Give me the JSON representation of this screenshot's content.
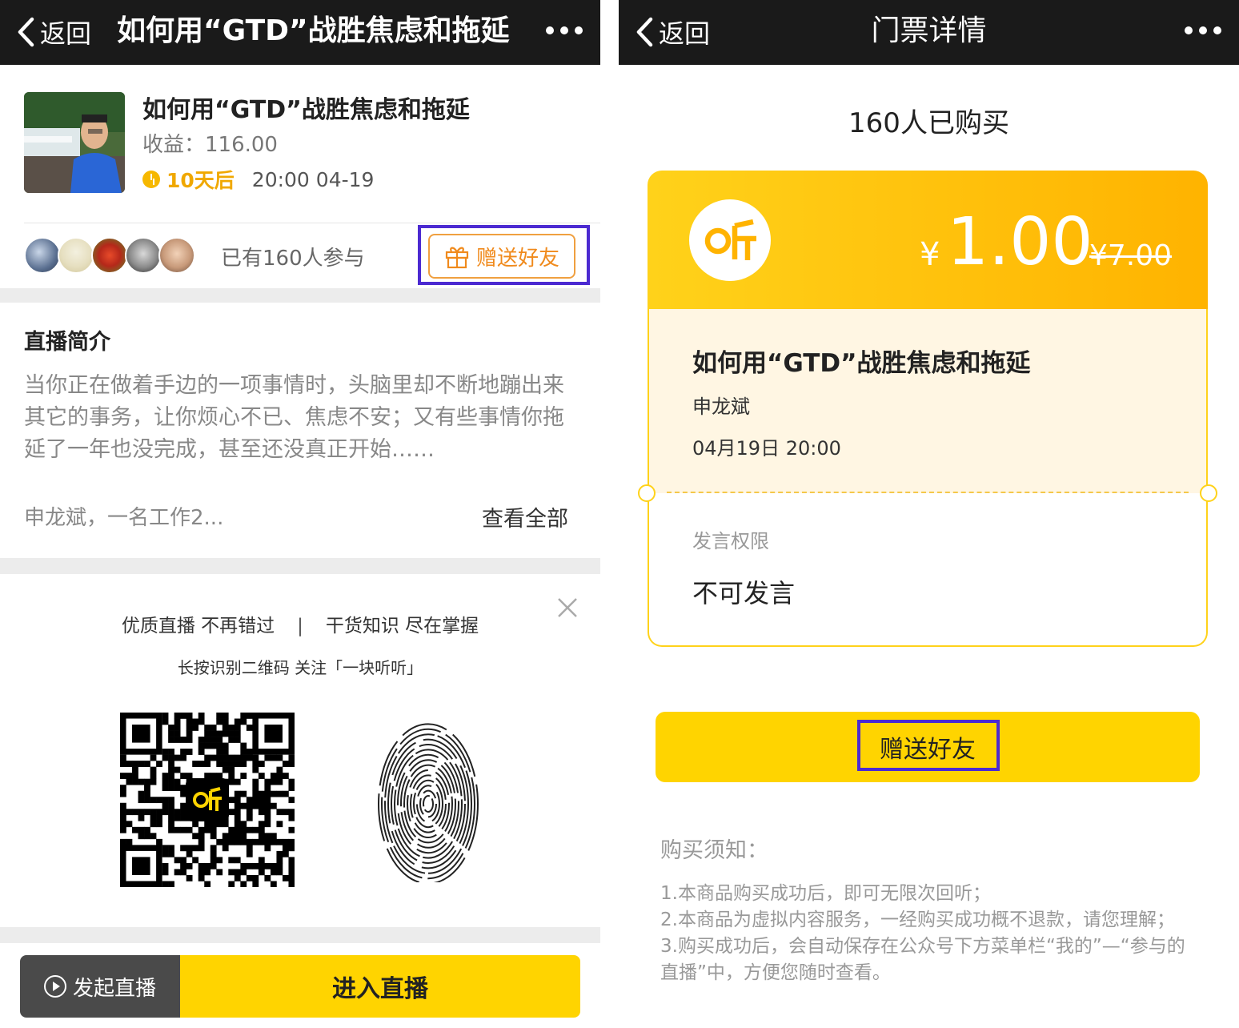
{
  "left": {
    "nav": {
      "back_label": "返回",
      "title": "如何用“GTD”战胜焦虑和拖延"
    },
    "course": {
      "title": "如何用“GTD”战胜焦虑和拖延",
      "income": "收益：116.00",
      "countdown": "10天后",
      "datetime": "20:00 04-19"
    },
    "participants": "已有160人参与",
    "gift_button": "赠送好友",
    "intro": {
      "title": "直播简介",
      "text": "当你正在做着手边的一项事情时，头脑里却不断地蹦出来其它的事务，让你烦心不已、焦虑不安；又有些事情你拖延了一年也没完成，甚至还没真正开始……",
      "author_line": "申龙斌，一名工作2...",
      "see_all": "查看全部"
    },
    "promo": {
      "slogan_left": "优质直播 不再错过",
      "slogan_sep": "|",
      "slogan_right": "干货知识 尽在掌握",
      "qr_hint": "长按识别二维码 关注「一块听听」"
    },
    "bottom": {
      "start_live": "发起直播",
      "enter_live": "进入直播"
    }
  },
  "right": {
    "nav": {
      "back_label": "返回",
      "title": "门票详情"
    },
    "buyers": "160人已购买",
    "ticket": {
      "currency": "¥",
      "price": "1.00",
      "original_price": "¥7.00",
      "title": "如何用“GTD”战胜焦虑和拖延",
      "author": "申龙斌",
      "datetime": "04月19日 20:00",
      "permission_label": "发言权限",
      "permission_value": "不可发言"
    },
    "gift_button": "赠送好友",
    "notice": {
      "title": "购买须知：",
      "items": [
        "1.本商品购买成功后，即可无限次回听；",
        "2.本商品为虚拟内容服务，一经购买成功概不退款，请您理解；",
        "3.购买成功后，会自动保存在公众号下方菜单栏“我的”—“参与的直播”中，方便您随时查看。"
      ]
    }
  },
  "colors": {
    "nav_bg": "#1a1a1a",
    "accent_yellow": "#ffd400",
    "accent_orange": "#f08a1c",
    "highlight_box": "#4b2ad1",
    "ticket_cream": "#fff6e3"
  },
  "icons": [
    "chevron-left-icon",
    "more-dots-icon",
    "clock-icon",
    "gift-icon",
    "close-icon",
    "play-circle-icon",
    "ting-logo-icon",
    "qr-code",
    "fingerprint-icon"
  ]
}
